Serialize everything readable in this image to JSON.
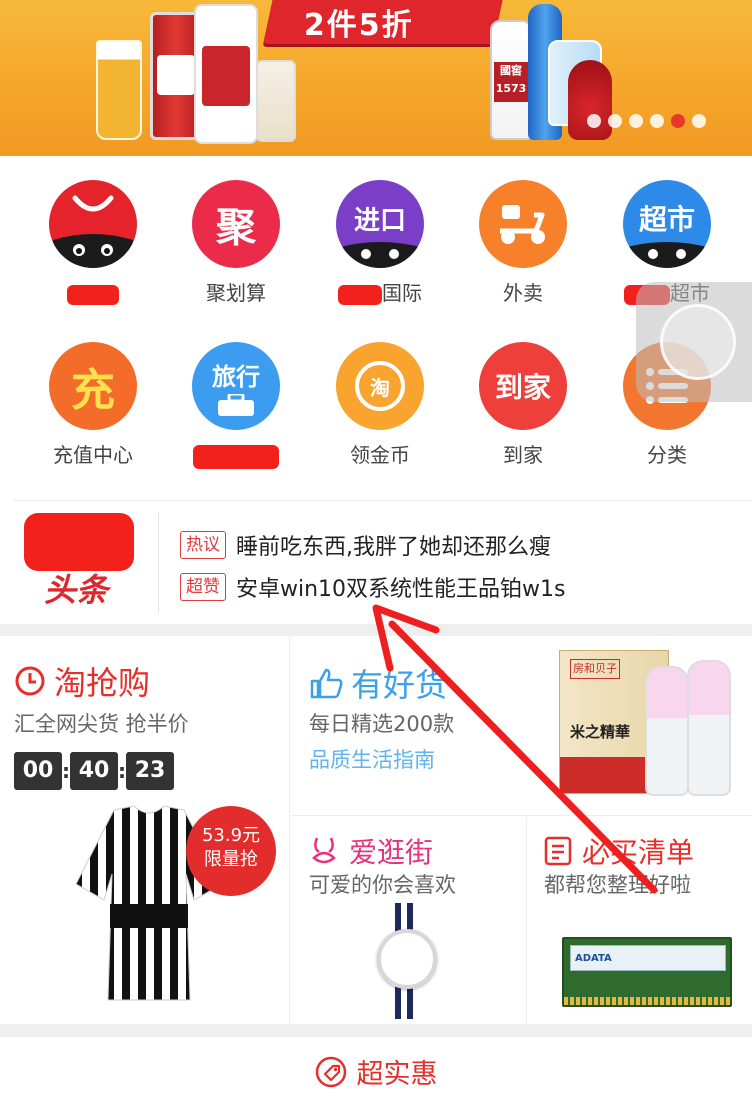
{
  "banner": {
    "headline": "2件5折",
    "bottle_labels": [
      "國窖",
      "1573"
    ],
    "carousel_dots": 6,
    "carousel_active": 5
  },
  "grid": {
    "row1": [
      {
        "label": "",
        "icon": "tmall-cart-icon",
        "color": "#e5232b",
        "redacted": true
      },
      {
        "label": "聚划算",
        "icon_text": "聚",
        "icon": "juhuasuan-icon",
        "color": "#ea2b4a"
      },
      {
        "label": "国际",
        "icon_text": "进口",
        "icon": "import-icon",
        "color": "#7b3fc7",
        "partial_redacted": true
      },
      {
        "label": "外卖",
        "icon": "scooter-icon",
        "color": "#f7802a"
      },
      {
        "label": "超市",
        "icon_text": "超市",
        "icon": "supermarket-icon",
        "color": "#2d8ae8",
        "partial_redacted": true
      }
    ],
    "row2": [
      {
        "label": "充值中心",
        "icon_text": "充",
        "icon": "recharge-icon",
        "color": "#f36c2a"
      },
      {
        "label": "",
        "icon_text": "旅行",
        "icon": "travel-icon",
        "color": "#3b9cf0",
        "redacted": true
      },
      {
        "label": "领金币",
        "icon_text": "淘",
        "icon": "coin-icon",
        "color": "#f9a42e"
      },
      {
        "label": "到家",
        "icon_text": "到家",
        "icon": "home-delivery-icon",
        "color": "#ee3f3b"
      },
      {
        "label": "分类",
        "icon": "category-list-icon",
        "color": "#f37630"
      }
    ]
  },
  "headline": {
    "logo_text": "头条",
    "items": [
      {
        "tag": "热议",
        "text": "睡前吃东西,我胖了她却还那么瘦"
      },
      {
        "tag": "超赞",
        "text": "安卓win10双系统性能王品铂w1s"
      }
    ]
  },
  "taoqianggou": {
    "title": "淘抢购",
    "subtitle": "汇全网尖货 抢半价",
    "countdown": [
      "00",
      "40",
      "23"
    ],
    "price": "53.9元",
    "price_note": "限量抢"
  },
  "youhaohuo": {
    "title": "有好货",
    "subtitle": "每日精选200款",
    "link": "品质生活指南",
    "product_text": "米之精華",
    "product_brand": "房和贝子"
  },
  "aiguangjie": {
    "title": "爱逛街",
    "subtitle": "可爱的你会喜欢"
  },
  "bimai": {
    "title": "必买清单",
    "subtitle": "都帮您整理好啦",
    "product_text": "ADATA"
  },
  "chaoshihui": {
    "title": "超实惠"
  },
  "colors": {
    "accent_red": "#e62f2a",
    "link_blue": "#3aa0e8",
    "pink": "#e6337d"
  }
}
